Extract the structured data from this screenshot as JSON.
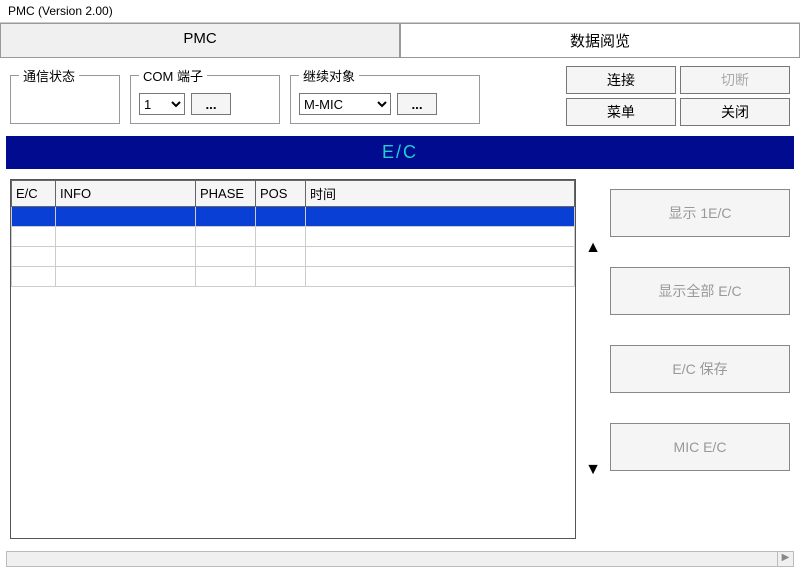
{
  "window": {
    "title": "PMC (Version 2.00)"
  },
  "tabs": {
    "pmc": "PMC",
    "data_view": "数据阅览"
  },
  "groups": {
    "comm_status": "通信状态",
    "com_port": "COM 端子",
    "target": "继续对象"
  },
  "com": {
    "selected": "1",
    "ellipsis": "..."
  },
  "target": {
    "selected": "M-MIC",
    "ellipsis": "..."
  },
  "buttons": {
    "connect": "连接",
    "disconnect": "切断",
    "menu": "菜单",
    "close": "关闭"
  },
  "section": {
    "title": "E/C"
  },
  "table": {
    "headers": {
      "ec": "E/C",
      "info": "INFO",
      "phase": "PHASE",
      "pos": "POS",
      "time": "时间"
    }
  },
  "side": {
    "show_one": "显示 1E/C",
    "show_all": "显示全部 E/C",
    "save": "E/C 保存",
    "mic": "MIC E/C"
  },
  "arrows": {
    "up": "▲",
    "down": "▼",
    "left": "◀",
    "right": "▶"
  }
}
